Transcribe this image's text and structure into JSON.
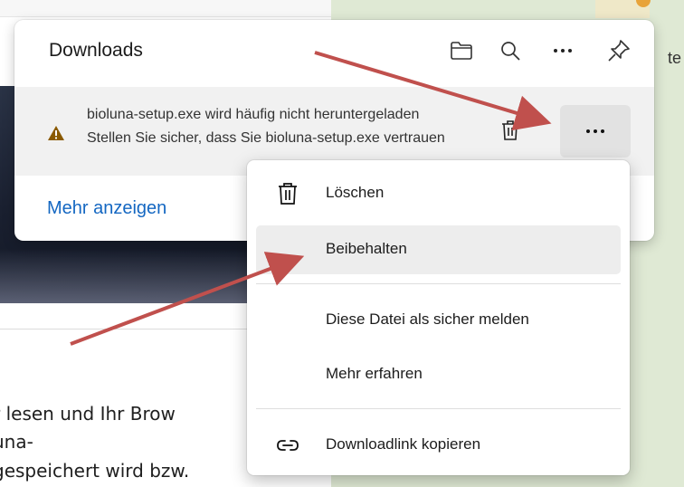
{
  "background": {
    "text_lines": [
      "r lesen und Ihr Brow",
      "una-",
      "gespeichert wird bzw."
    ],
    "right_fragment": "te"
  },
  "downloads": {
    "title": "Downloads",
    "toolbar_icons": [
      "folder-icon",
      "search-icon",
      "more-icon",
      "pin-icon"
    ],
    "item": {
      "line1": "bioluna-setup.exe wird häufig nicht heruntergeladen",
      "line2": "Stellen Sie sicher, dass Sie bioluna-setup.exe vertrauen",
      "status_icon": "warning-icon",
      "status_color": "#8a5a00"
    },
    "show_more": "Mehr anzeigen",
    "link_color": "#1467c2"
  },
  "context_menu": {
    "items": [
      {
        "label": "Löschen",
        "icon": "trash-icon"
      },
      {
        "label": "Beibehalten",
        "icon": ""
      },
      {
        "label": "Diese Datei als sicher melden",
        "icon": ""
      },
      {
        "label": "Mehr erfahren",
        "icon": ""
      },
      {
        "label": "Downloadlink kopieren",
        "icon": "link-icon"
      }
    ],
    "highlighted_item": "Beibehalten"
  },
  "annotation_color": "#c0504d"
}
